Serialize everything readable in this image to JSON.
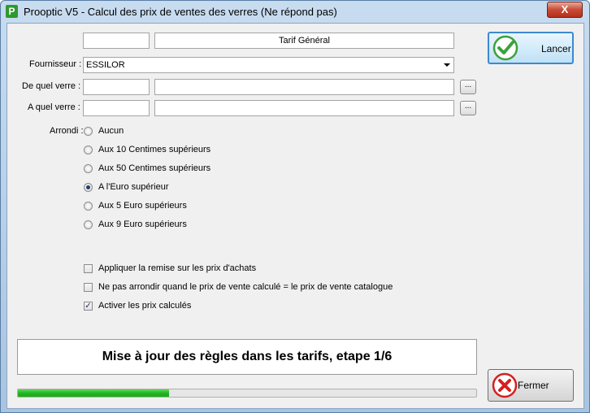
{
  "window": {
    "title": "Prooptic V5 - Calcul des prix de ventes des verres (Ne répond pas)",
    "app_icon_letter": "P",
    "close_symbol": "X"
  },
  "tarif": {
    "code_value": "",
    "name_value": "Tarif Général"
  },
  "fournisseur": {
    "label": "Fournisseur :",
    "value": "ESSILOR"
  },
  "de_quel_verre": {
    "label": "De quel verre :",
    "code_value": "",
    "name_value": "",
    "browse_label": "..."
  },
  "a_quel_verre": {
    "label": "A quel verre :",
    "code_value": "",
    "name_value": "",
    "browse_label": "..."
  },
  "arrondi": {
    "label": "Arrondi :",
    "options": [
      {
        "label": "Aucun",
        "selected": false
      },
      {
        "label": "Aux 10 Centimes supérieurs",
        "selected": false
      },
      {
        "label": "Aux 50 Centimes supérieurs",
        "selected": false
      },
      {
        "label": "A l'Euro supérieur",
        "selected": true
      },
      {
        "label": "Aux 5 Euro supérieurs",
        "selected": false
      },
      {
        "label": "Aux 9 Euro supérieurs",
        "selected": false
      }
    ]
  },
  "options": [
    {
      "label": "Appliquer la remise sur les prix d'achats",
      "checked": false
    },
    {
      "label": "Ne pas arrondir quand le prix de vente calculé = le prix de vente catalogue",
      "checked": false
    },
    {
      "label": "Activer les prix calculés",
      "checked": true
    }
  ],
  "status": {
    "message": "Mise à jour des règles dans les tarifs, etape 1/6",
    "progress_fraction": 0.33
  },
  "buttons": {
    "lancer_label": "Lancer",
    "fermer_label": "Fermer"
  },
  "colors": {
    "progress_green": "#22b422",
    "lancer_check": "#3aa23a",
    "fermer_x": "#d42020"
  }
}
